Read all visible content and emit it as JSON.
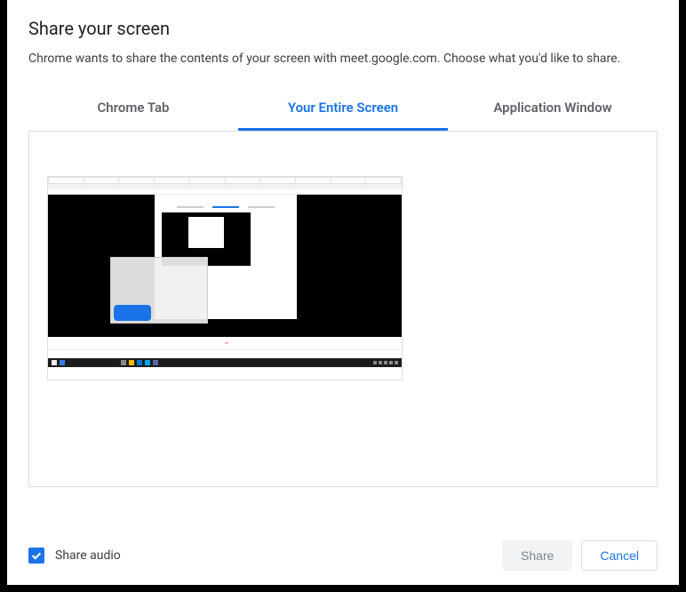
{
  "dialog": {
    "title": "Share your screen",
    "subtitle": "Chrome wants to share the contents of your screen with meet.google.com. Choose what you'd like to share."
  },
  "tabs": {
    "chrome_tab": "Chrome Tab",
    "entire_screen": "Your Entire Screen",
    "app_window": "Application Window",
    "active": "entire_screen"
  },
  "checkbox": {
    "label": "Share audio",
    "checked": true
  },
  "buttons": {
    "share": "Share",
    "cancel": "Cancel"
  },
  "colors": {
    "accent": "#1a73e8",
    "text_primary": "#202124",
    "text_secondary": "#5f6368"
  }
}
